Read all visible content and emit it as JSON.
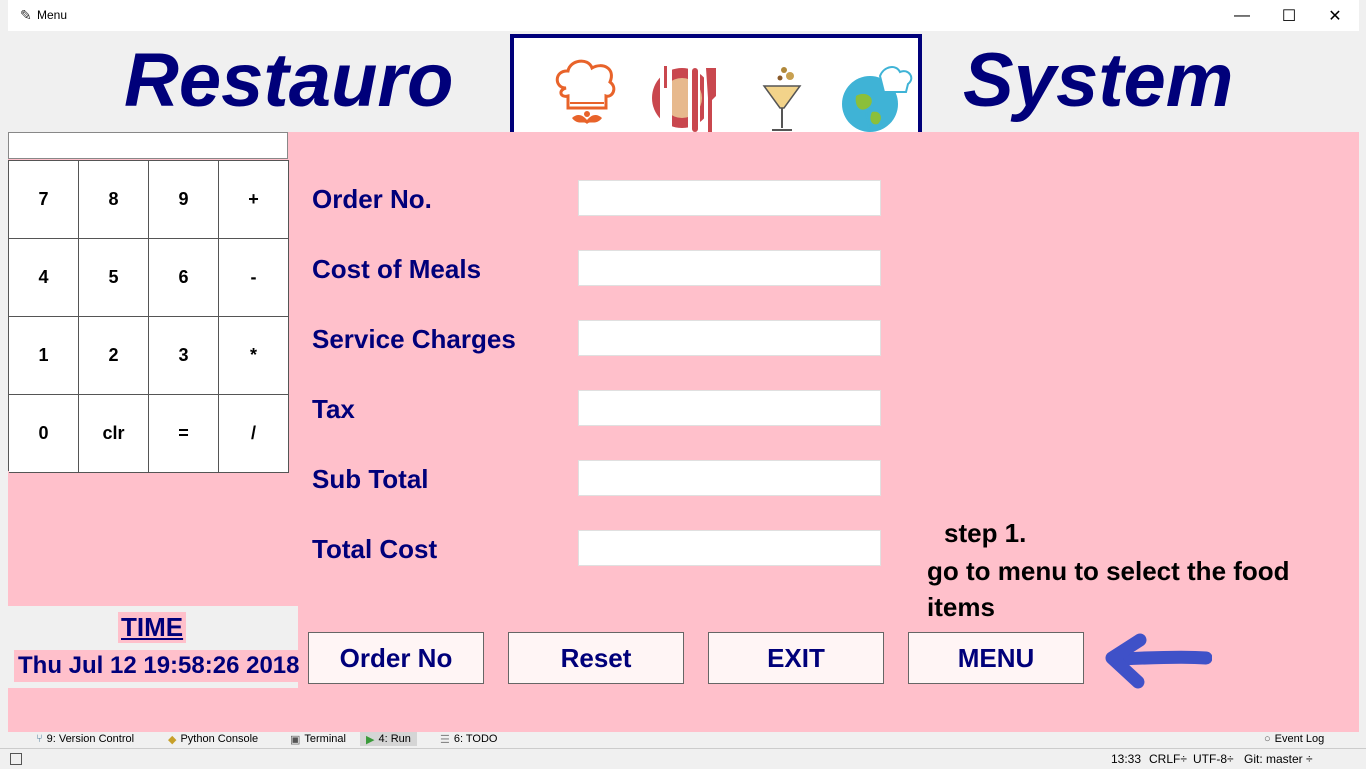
{
  "window": {
    "title": "Menu",
    "minimize": "—",
    "maximize": "☐",
    "close": "✕"
  },
  "header": {
    "left_title": "Restauro",
    "right_title": "System"
  },
  "logos": [
    "chef-hat-icon",
    "plate-cutlery-icon",
    "cocktail-glass-icon",
    "globe-chef-icon"
  ],
  "calculator": {
    "display_value": "",
    "keys": [
      "7",
      "8",
      "9",
      "+",
      "4",
      "5",
      "6",
      "-",
      "1",
      "2",
      "3",
      "*",
      "0",
      "clr",
      "=",
      "/"
    ]
  },
  "form": {
    "order_no": {
      "label": "Order No.",
      "value": ""
    },
    "cost_of_meals": {
      "label": "Cost of Meals",
      "value": ""
    },
    "service_charges": {
      "label": "Service Charges",
      "value": ""
    },
    "tax": {
      "label": "Tax",
      "value": ""
    },
    "sub_total": {
      "label": "Sub Total",
      "value": ""
    },
    "total_cost": {
      "label": "Total Cost",
      "value": ""
    }
  },
  "time": {
    "label": "TIME",
    "value": "Thu Jul 12 19:58:26 2018"
  },
  "buttons": {
    "order_no": "Order No",
    "reset": "Reset",
    "exit": "EXIT",
    "menu": "MENU"
  },
  "instruction": {
    "step": "step  1.",
    "line1": "go to menu to select the food",
    "line2": "items"
  },
  "ide_tabs": [
    {
      "label": "9: Version Control",
      "icon": "version-control-icon"
    },
    {
      "label": "Python Console",
      "icon": "python-icon"
    },
    {
      "label": "Terminal",
      "icon": "terminal-icon"
    },
    {
      "label": "4: Run",
      "icon": "run-icon"
    },
    {
      "label": "6: TODO",
      "icon": "todo-icon"
    }
  ],
  "event_log": "Event Log",
  "status": {
    "time": "13:33",
    "line_sep": "CRLF÷",
    "encoding": "UTF-8÷",
    "git": "Git: master ÷"
  },
  "colors": {
    "pink_bg": "#ffc0cb",
    "navy": "#00007a",
    "arrow": "#3f51c8"
  }
}
